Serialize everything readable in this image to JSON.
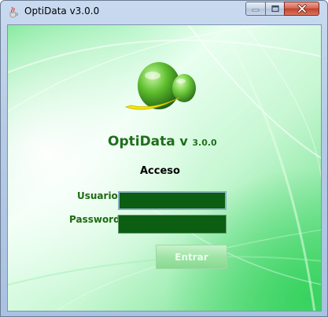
{
  "window": {
    "title": "OptiData v3.0.0",
    "icon": "java-cup-icon"
  },
  "controls": {
    "minimize": "minimize-icon",
    "maximize": "maximize-icon",
    "close": "close-icon"
  },
  "brand": {
    "name": "OptiData",
    "v": "v",
    "version": "3.0.0"
  },
  "login": {
    "heading": "Acceso",
    "user_label": "Usuario",
    "user_value": "",
    "password_label": "Password",
    "password_value": "",
    "submit_label": "Entrar"
  },
  "colors": {
    "brand_text": "#1f6f1a",
    "field_bg": "#0b5e12",
    "button_bg": "#9ee3a5"
  }
}
